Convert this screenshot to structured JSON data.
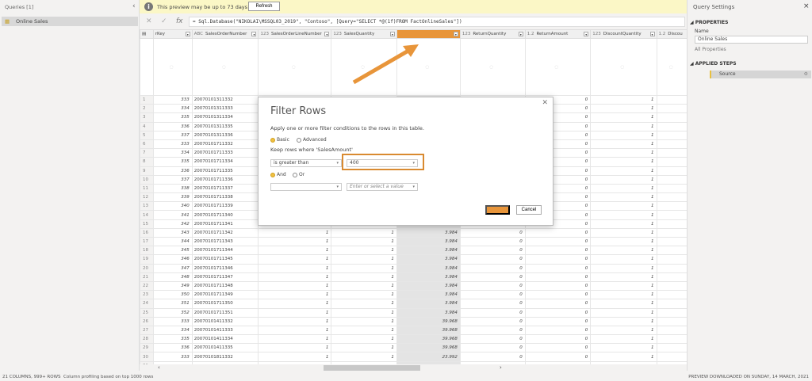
{
  "queries": {
    "header": "Queries [1]",
    "items": [
      {
        "label": "Online Sales"
      }
    ]
  },
  "banner": {
    "message": "This preview may be up to 73 days old.",
    "refresh_label": "Refresh"
  },
  "formula_bar": {
    "formula": "= Sql.Database(\"NIKOLAI\\MSSQL03_2019\", \"Contoso\", [Query=\"SELECT *@(1f)FROM FactOnlineSales\"])"
  },
  "columns": [
    {
      "name": "rKey",
      "type_icon": "table-icon"
    },
    {
      "name": "SalesOrderNumber",
      "type_icon": "ABC"
    },
    {
      "name": "SalesOrderLineNumber",
      "type_icon": "123"
    },
    {
      "name": "SalesQuantity",
      "type_icon": "123"
    },
    {
      "name": "",
      "type_icon": "",
      "selected": true
    },
    {
      "name": "ReturnQuantity",
      "type_icon": "123"
    },
    {
      "name": "ReturnAmount",
      "type_icon": "1.2"
    },
    {
      "name": "DiscountQuantity",
      "type_icon": "123"
    },
    {
      "name": "Discou",
      "type_icon": "1.2"
    }
  ],
  "rows": {
    "key": [
      333,
      334,
      335,
      336,
      337,
      333,
      334,
      335,
      336,
      337,
      338,
      339,
      340,
      341,
      342,
      343,
      344,
      345,
      346,
      347,
      348,
      349,
      350,
      351,
      352,
      333,
      334,
      335,
      336,
      333
    ],
    "order_number": [
      "20070101311332",
      "20070101311333",
      "20070101311334",
      "20070101311335",
      "20070101311336",
      "20070101711332",
      "20070101711333",
      "20070101711334",
      "20070101711335",
      "20070101711336",
      "20070101711337",
      "20070101711338",
      "20070101711339",
      "20070101711340",
      "20070101711341",
      "20070101711342",
      "20070101711343",
      "20070101711344",
      "20070101711345",
      "20070101711346",
      "20070101711347",
      "20070101711348",
      "20070101711349",
      "20070101711350",
      "20070101711351",
      "20070101411332",
      "20070101411333",
      "20070101411334",
      "20070101411335",
      "20070101811332"
    ],
    "line_number": [
      null,
      null,
      null,
      null,
      null,
      null,
      null,
      null,
      null,
      null,
      null,
      null,
      null,
      1,
      1,
      1,
      1,
      1,
      1,
      1,
      1,
      1,
      1,
      1,
      1,
      1,
      1,
      1,
      1,
      1
    ],
    "sales_quantity": [
      null,
      null,
      null,
      null,
      null,
      null,
      null,
      null,
      null,
      null,
      null,
      null,
      null,
      null,
      1,
      1,
      1,
      1,
      1,
      1,
      1,
      1,
      1,
      1,
      1,
      1,
      1,
      1,
      1,
      1
    ],
    "sales_amount": [
      null,
      null,
      null,
      null,
      null,
      null,
      null,
      null,
      null,
      null,
      null,
      null,
      null,
      null,
      "3.984",
      "3.984",
      "3.984",
      "3.984",
      "3.984",
      "3.984",
      "3.984",
      "3.984",
      "3.984",
      "3.984",
      "3.984",
      "39.968",
      "39.968",
      "39.968",
      "39.968",
      "23.992"
    ],
    "return_quantity": [
      null,
      null,
      null,
      null,
      null,
      null,
      null,
      null,
      null,
      null,
      null,
      null,
      null,
      null,
      0,
      0,
      0,
      0,
      0,
      0,
      0,
      0,
      0,
      0,
      0,
      0,
      0,
      0,
      0,
      0
    ],
    "return_amount": [
      0,
      0,
      0,
      0,
      0,
      0,
      0,
      0,
      0,
      0,
      0,
      0,
      0,
      0,
      0,
      0,
      0,
      0,
      0,
      0,
      0,
      0,
      0,
      0,
      0,
      0,
      0,
      0,
      0,
      0
    ],
    "discount_quantity": [
      1,
      1,
      1,
      1,
      1,
      1,
      1,
      1,
      1,
      1,
      1,
      1,
      1,
      1,
      1,
      1,
      1,
      1,
      1,
      1,
      1,
      1,
      1,
      1,
      1,
      1,
      1,
      1,
      1,
      1
    ],
    "last_row_number": 31
  },
  "dialog": {
    "title": "Filter Rows",
    "description": "Apply one or more filter conditions to the rows in this table.",
    "mode_basic": "Basic",
    "mode_advanced": "Advanced",
    "mode_selected": "Basic",
    "keep_label": "Keep rows where 'SalesAmount'",
    "operator1": "is greater than",
    "value1": "400",
    "and_label": "And",
    "or_label": "Or",
    "logic_selected": "And",
    "operator2": "",
    "value2_placeholder": "Enter or select a value",
    "ok_label": "",
    "cancel_label": "Cancel"
  },
  "settings": {
    "title": "Query Settings",
    "properties_header": "PROPERTIES",
    "name_label": "Name",
    "name_value": "Online Sales",
    "all_properties": "All Properties",
    "applied_steps_header": "APPLIED STEPS",
    "steps": [
      {
        "label": "Source"
      }
    ]
  },
  "status": {
    "left": "21 COLUMNS, 999+ ROWS",
    "profiling": "Column profiling based on top 1000 rows",
    "right": "PREVIEW DOWNLOADED ON SUNDAY, 14 MARCH, 2021"
  },
  "colors": {
    "accent": "#e8953a",
    "banner": "#fbf7c6",
    "selected_column": "#e4e4e4"
  }
}
